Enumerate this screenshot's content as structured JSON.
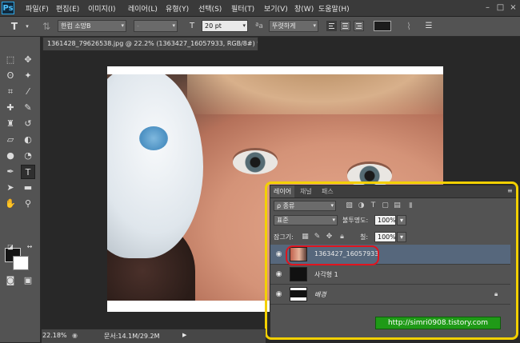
{
  "app": {
    "logo": "Ps"
  },
  "menu": [
    "파일(F)",
    "편집(E)",
    "이미지(I)",
    "레이어(L)",
    "유형(Y)",
    "선택(S)",
    "필터(T)",
    "보기(V)",
    "창(W)",
    "도움말(H)"
  ],
  "window_controls": {
    "minimize": "–",
    "maximize": "□",
    "close": "×"
  },
  "options_bar": {
    "tool_glyph": "T",
    "font_family": "한컴 소망B",
    "font_style": "-",
    "font_size": "20 pt",
    "size_label_glyph": "T",
    "aa_label": "ªa",
    "antialias": "뚜렷하게",
    "text_color": "#1c1c1c"
  },
  "document": {
    "tab_title": "1361428_79626538.jpg @ 22.2% (1363427_16057933, RGB/8#) *",
    "tab_close": "×",
    "zoom": "22.18%",
    "doc_info": "문서:14.1M/29.2M"
  },
  "layers_panel": {
    "tabs": [
      "레이어",
      "채널",
      "패스"
    ],
    "kind_filter": "ρ 종류",
    "blend_mode": "표준",
    "opacity_label": "불투명도:",
    "opacity": "100%",
    "lock_label": "잠그기:",
    "fill_label": "칠:",
    "fill": "100%",
    "layers": [
      {
        "name": "1363427_16057933",
        "visible": true,
        "selected": true
      },
      {
        "name": "사각형 1",
        "visible": true,
        "selected": false
      },
      {
        "name": "배경",
        "visible": true,
        "selected": false,
        "locked": true
      }
    ]
  },
  "watermark": {
    "text": "http://simri0908.tistory.com"
  },
  "colors": {
    "highlight": "#f3d000",
    "selected_outline": "#e0141e",
    "watermark_bg": "#1f9a17",
    "selected_layer": "#56677c"
  }
}
